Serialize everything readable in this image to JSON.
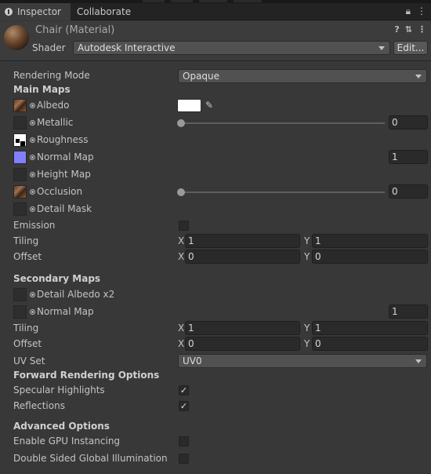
{
  "tabs": {
    "inspector": "Inspector",
    "collaborate": "Collaborate"
  },
  "header": {
    "title": "Chair (Material)",
    "shader_label": "Shader",
    "shader_value": "Autodesk Interactive",
    "edit_button": "Edit..."
  },
  "rendering_mode": {
    "label": "Rendering Mode",
    "value": "Opaque"
  },
  "main_maps": {
    "heading": "Main Maps",
    "albedo": "Albedo",
    "metallic": {
      "label": "Metallic",
      "value": "0",
      "slider_fraction": 0
    },
    "roughness": "Roughness",
    "normal_map": {
      "label": "Normal Map",
      "value": "1"
    },
    "height_map": "Height Map",
    "occlusion": {
      "label": "Occlusion",
      "value": "0",
      "slider_fraction": 0
    },
    "detail_mask": "Detail Mask",
    "emission": "Emission",
    "tiling": {
      "label": "Tiling",
      "x": "1",
      "y": "1"
    },
    "offset": {
      "label": "Offset",
      "x": "0",
      "y": "0"
    }
  },
  "secondary_maps": {
    "heading": "Secondary Maps",
    "detail_albedo": "Detail Albedo x2",
    "normal_map": {
      "label": "Normal Map",
      "value": "1"
    },
    "tiling": {
      "label": "Tiling",
      "x": "1",
      "y": "1"
    },
    "offset": {
      "label": "Offset",
      "x": "0",
      "y": "0"
    },
    "uv_set": {
      "label": "UV Set",
      "value": "UV0"
    }
  },
  "forward_rendering": {
    "heading": "Forward Rendering Options",
    "specular_highlights": {
      "label": "Specular Highlights",
      "checked": true
    },
    "reflections": {
      "label": "Reflections",
      "checked": true
    }
  },
  "advanced": {
    "heading": "Advanced Options",
    "gpu_instancing": {
      "label": "Enable GPU Instancing",
      "checked": false
    },
    "double_sided_gi": {
      "label": "Double Sided Global Illumination",
      "checked": false
    }
  },
  "axis": {
    "x": "X",
    "y": "Y"
  },
  "icons": {
    "lock": "lock-icon",
    "menu": "kebab-menu-icon",
    "help": "help-icon",
    "settings": "preset-settings-icon",
    "picker": "eyedropper-icon",
    "check": "✓"
  },
  "colors": {
    "background": "#383838",
    "normal_map_tint": "#8080ff",
    "albedo_color": "#ffffff"
  }
}
